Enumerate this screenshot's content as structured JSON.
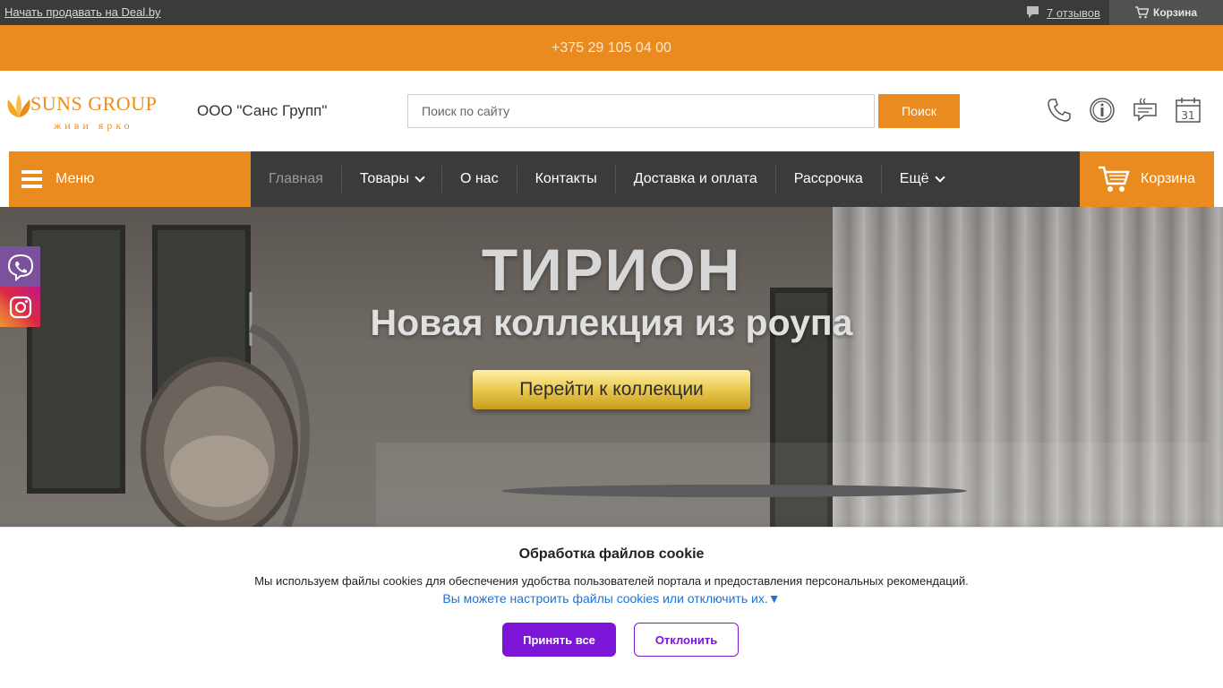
{
  "topbar": {
    "sell_link": "Начать продавать на Deal.by",
    "reviews": "7 отзывов",
    "cart": "Корзина"
  },
  "phonebar": {
    "phone": "+375 29 105 04 00"
  },
  "header": {
    "logo_brand": "SUNS GROUP",
    "logo_slogan": "живи ярко",
    "company": "ООО \"Санс Групп\"",
    "search_placeholder": "Поиск по сайту",
    "search_button": "Поиск"
  },
  "nav": {
    "menu": "Меню",
    "items": [
      {
        "label": "Главная"
      },
      {
        "label": "Товары"
      },
      {
        "label": "О нас"
      },
      {
        "label": "Контакты"
      },
      {
        "label": "Доставка и оплата"
      },
      {
        "label": "Рассрочка"
      },
      {
        "label": "Ещё"
      }
    ],
    "cart": "Корзина"
  },
  "banner": {
    "title": "ТИРИОН",
    "subtitle": "Новая коллекция из роупа",
    "cta": "Перейти к коллекции"
  },
  "cookie": {
    "title": "Обработка файлов cookie",
    "text": "Мы используем файлы cookies для обеспечения удобства пользователей портала и предоставления персональных рекомендаций.",
    "link": "Вы можете настроить файлы cookies или отключить их.▼",
    "accept": "Принять все",
    "decline": "Отклонить"
  },
  "colors": {
    "accent": "#e98b1f",
    "dark": "#3b3b3b",
    "cookie_button": "#7b16d8",
    "link": "#1a73d9"
  }
}
